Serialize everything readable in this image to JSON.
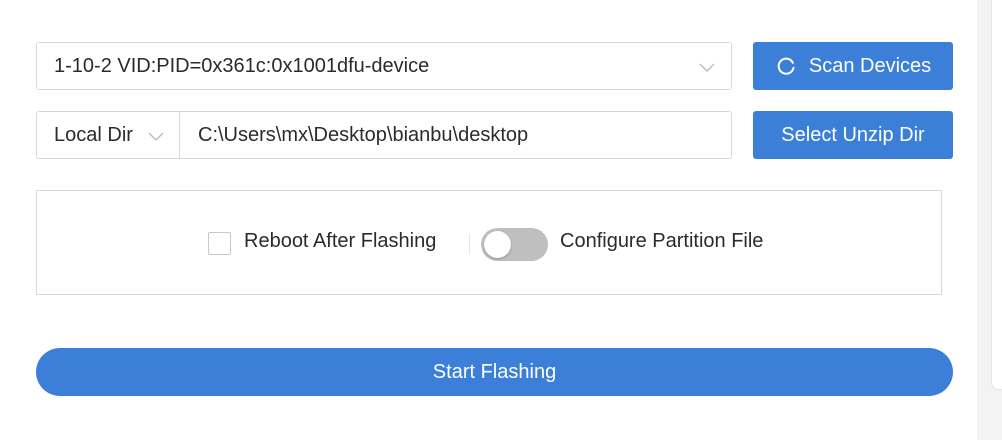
{
  "device": {
    "selected": "1-10-2 VID:PID=0x361c:0x1001dfu-device",
    "dropdown_icon": "chevron-down-icon"
  },
  "scan_button": {
    "label": "Scan Devices",
    "icon": "refresh-icon"
  },
  "source": {
    "type_selected": "Local Dir",
    "dropdown_icon": "chevron-down-icon",
    "path": "C:\\Users\\mx\\Desktop\\bianbu\\desktop"
  },
  "unzip_button": {
    "label": "Select Unzip Dir"
  },
  "options": {
    "reboot_label": "Reboot After Flashing",
    "reboot_checked": false,
    "partition_label": "Configure Partition File",
    "partition_enabled": false
  },
  "start_button": {
    "label": "Start Flashing"
  },
  "colors": {
    "accent": "#3b7fd9",
    "border": "#d9d9d9",
    "toggle_off": "#bfbfbf"
  }
}
